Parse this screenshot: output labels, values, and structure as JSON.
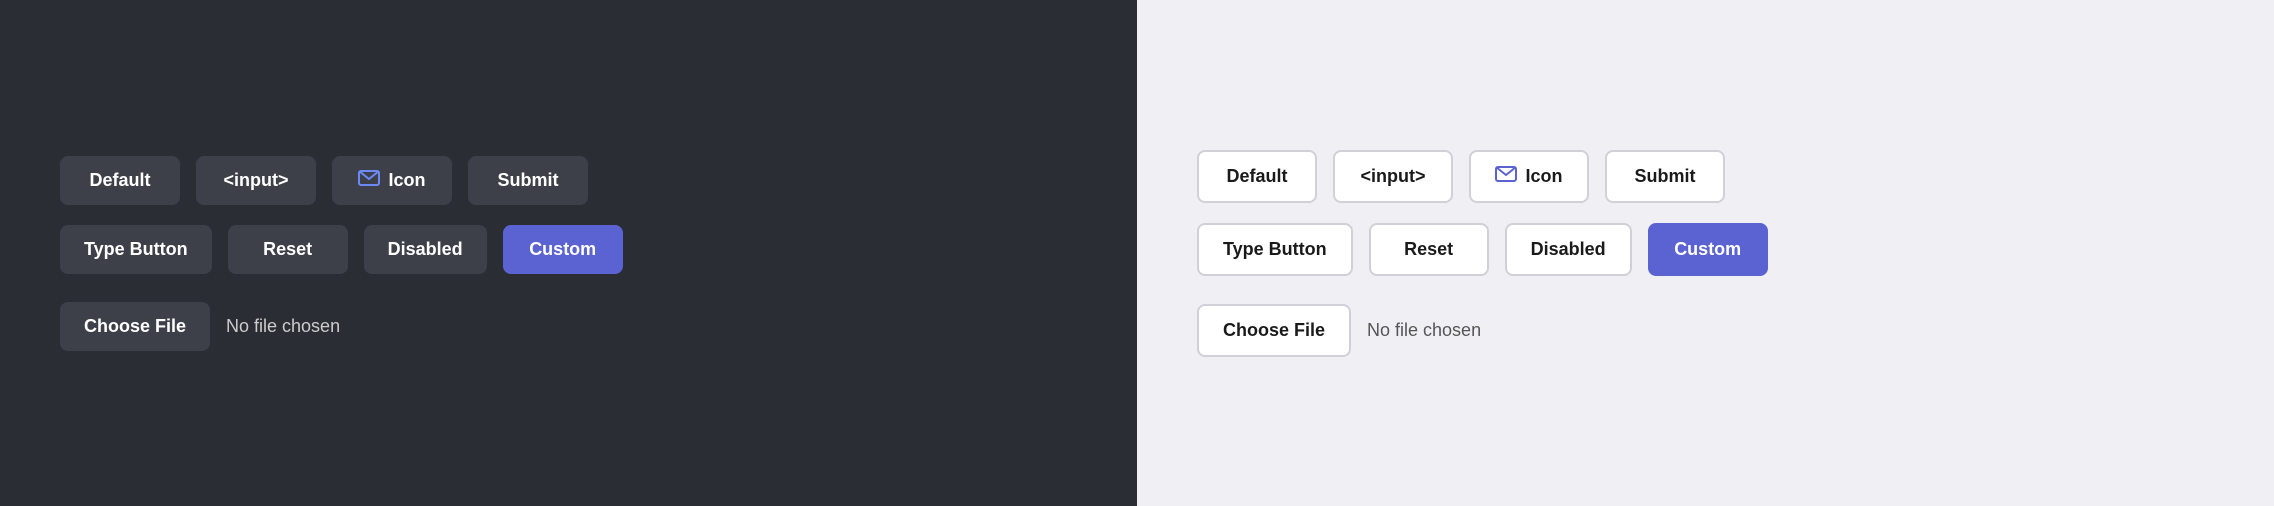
{
  "dark_panel": {
    "row1": {
      "buttons": [
        {
          "id": "default",
          "label": "Default",
          "variant": "default"
        },
        {
          "id": "input",
          "label": "<input>",
          "variant": "default"
        },
        {
          "id": "icon",
          "label": "Icon",
          "variant": "icon"
        },
        {
          "id": "submit",
          "label": "Submit",
          "variant": "default"
        }
      ]
    },
    "row2": {
      "buttons": [
        {
          "id": "type-button",
          "label": "Type Button",
          "variant": "default"
        },
        {
          "id": "reset",
          "label": "Reset",
          "variant": "default"
        },
        {
          "id": "disabled",
          "label": "Disabled",
          "variant": "default"
        },
        {
          "id": "custom",
          "label": "Custom",
          "variant": "custom"
        }
      ]
    },
    "file": {
      "label": "Choose File",
      "no_file_text": "No file chosen"
    }
  },
  "light_panel": {
    "row1": {
      "buttons": [
        {
          "id": "default",
          "label": "Default",
          "variant": "default"
        },
        {
          "id": "input",
          "label": "<input>",
          "variant": "default"
        },
        {
          "id": "icon",
          "label": "Icon",
          "variant": "icon"
        },
        {
          "id": "submit",
          "label": "Submit",
          "variant": "default"
        }
      ]
    },
    "row2": {
      "buttons": [
        {
          "id": "type-button",
          "label": "Type Button",
          "variant": "default"
        },
        {
          "id": "reset",
          "label": "Reset",
          "variant": "default"
        },
        {
          "id": "disabled",
          "label": "Disabled",
          "variant": "default"
        },
        {
          "id": "custom",
          "label": "Custom",
          "variant": "custom"
        }
      ]
    },
    "file": {
      "label": "Choose File",
      "no_file_text": "No file chosen"
    }
  }
}
